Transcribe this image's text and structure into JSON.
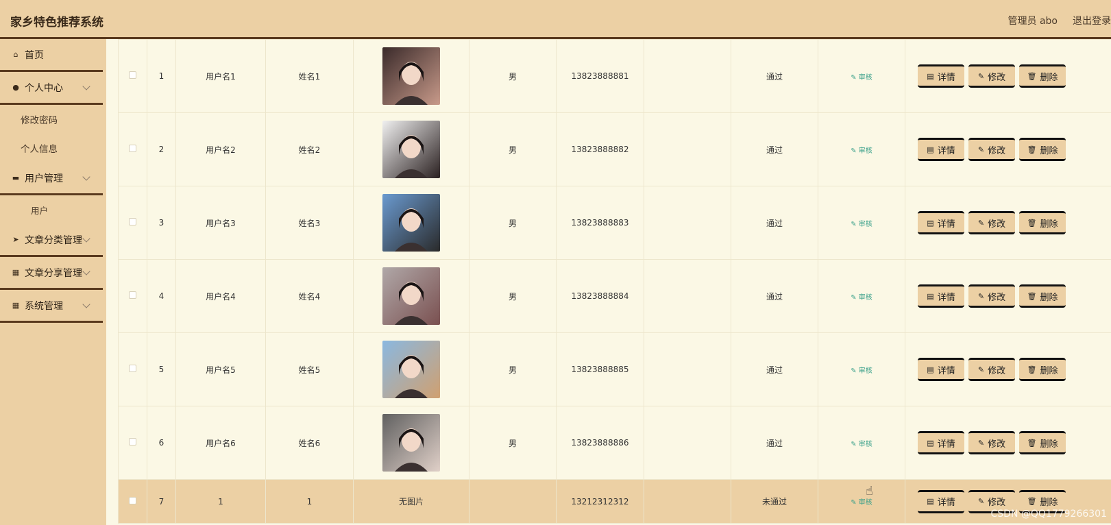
{
  "header": {
    "title": "家乡特色推荐系统",
    "admin": "管理员 abo",
    "logout": "退出登录"
  },
  "sidebar": {
    "home": "首页",
    "personal": "个人中心",
    "personal_sub": [
      "修改密码",
      "个人信息"
    ],
    "user_mgmt": "用户管理",
    "user_sub": "用户",
    "article_cat": "文章分类管理",
    "article_share": "文章分享管理",
    "system": "系统管理"
  },
  "actions": {
    "audit": "审核",
    "detail": "详情",
    "edit": "修改",
    "delete": "删除"
  },
  "rows": [
    {
      "idx": "1",
      "username": "用户名1",
      "name": "姓名1",
      "photo": "",
      "gender": "男",
      "phone": "13823888881",
      "col8": "",
      "status": "通过"
    },
    {
      "idx": "2",
      "username": "用户名2",
      "name": "姓名2",
      "photo": "",
      "gender": "男",
      "phone": "13823888882",
      "col8": "",
      "status": "通过"
    },
    {
      "idx": "3",
      "username": "用户名3",
      "name": "姓名3",
      "photo": "",
      "gender": "男",
      "phone": "13823888883",
      "col8": "",
      "status": "通过"
    },
    {
      "idx": "4",
      "username": "用户名4",
      "name": "姓名4",
      "photo": "",
      "gender": "男",
      "phone": "13823888884",
      "col8": "",
      "status": "通过"
    },
    {
      "idx": "5",
      "username": "用户名5",
      "name": "姓名5",
      "photo": "",
      "gender": "男",
      "phone": "13823888885",
      "col8": "",
      "status": "通过"
    },
    {
      "idx": "6",
      "username": "用户名6",
      "name": "姓名6",
      "photo": "",
      "gender": "男",
      "phone": "13823888886",
      "col8": "",
      "status": "通过"
    },
    {
      "idx": "7",
      "username": "1",
      "name": "1",
      "photo": "无图片",
      "gender": "",
      "phone": "13212312312",
      "col8": "",
      "status": "未通过"
    }
  ],
  "watermark": "CSDN @QQ1779266301",
  "colors": {
    "accent": "#ecd0a4",
    "border": "#5a3a1e",
    "bg": "#fbf8e5",
    "audit": "#3aa08a"
  }
}
